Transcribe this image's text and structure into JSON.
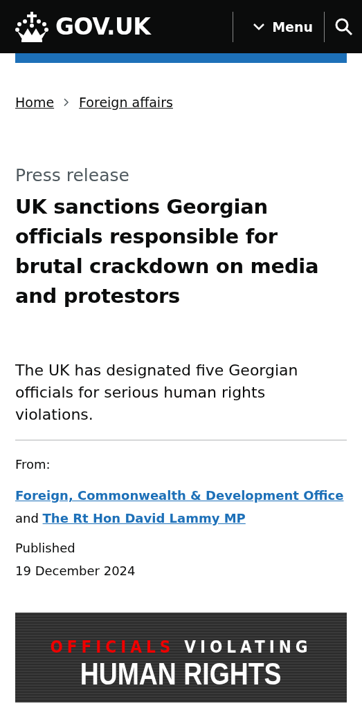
{
  "header": {
    "logo": "GOV.UK",
    "menu_label": "Menu"
  },
  "breadcrumbs": [
    {
      "label": "Home"
    },
    {
      "label": "Foreign affairs"
    }
  ],
  "document_type": "Press release",
  "title": "UK sanctions Georgian officials responsible for brutal crackdown on media and protestors",
  "lead": "The UK has designated five Georgian officials for serious human rights violations.",
  "metadata": {
    "from_label": "From:",
    "organisations": [
      {
        "label": "Foreign, Commonwealth & Development Office"
      },
      {
        "label": "The Rt Hon David Lammy MP"
      }
    ],
    "joiner": "and",
    "published_label": "Published",
    "published_date": "19 December 2024"
  },
  "banner": {
    "line_1a": "OFFICIALS",
    "line_1b": "VIOLATING",
    "line_2": "HUMAN RIGHTS"
  }
}
